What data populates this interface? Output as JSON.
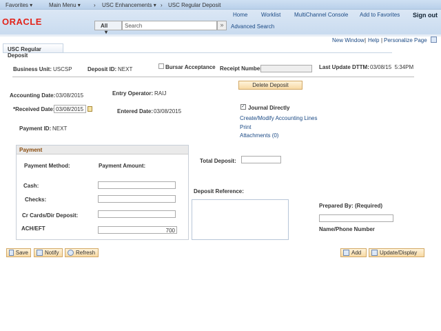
{
  "nav": {
    "favorites": "Favorites ▾",
    "main_menu": "Main Menu ▾",
    "sep1": "›",
    "enh": "USC Enhancements ▾",
    "sep2": "›",
    "page": "USC Regular Deposit"
  },
  "header": {
    "logo": "ORACLE",
    "home": "Home",
    "worklist": "Worklist",
    "mcc": "MultiChannel Console",
    "add_fav": "Add to Favorites",
    "sign_out": "Sign out",
    "search_scope": "All",
    "search_placeholder": "Search",
    "search_go": "»",
    "advanced": "Advanced Search"
  },
  "util": {
    "new_window": "New Window",
    "help": "Help",
    "personalize": "Personalize Page"
  },
  "tab": "USC Regular Deposit",
  "form": {
    "business_unit_label": "Business Unit:",
    "business_unit": "USCSP",
    "deposit_id_label": "Deposit ID:",
    "deposit_id": "NEXT",
    "bursar_label": "Bursar Acceptance",
    "bursar_checked": false,
    "receipt_label": "Receipt Number",
    "receipt_value": "",
    "last_update_label": "Last Update DTTM:",
    "last_update": "03/08/15  5:34PM",
    "delete_button": "Delete Deposit",
    "accounting_date_label": "Accounting Date:",
    "accounting_date": "03/08/2015",
    "entry_operator_label": "Entry Operator:",
    "entry_operator": "RAIJ",
    "received_date_label": "*Received Date:",
    "received_date": "03/08/2015",
    "entered_date_label": "Entered Date:",
    "entered_date": "03/08/2015",
    "journal_label": "Journal Directly",
    "journal_checked": true,
    "create_modify": "Create/Modify Accounting Lines",
    "print": "Print",
    "attachments": "Attachments (0)",
    "payment_id_label": "Payment ID:",
    "payment_id": "NEXT",
    "total_deposit_label": "Total Deposit:",
    "total_deposit": "",
    "deposit_ref_label": "Deposit Reference:",
    "deposit_ref": "",
    "prepared_by_label": "Prepared By: (Required)",
    "prepared_by": "",
    "name_phone_label": "Name/Phone Number"
  },
  "payment": {
    "title": "Payment",
    "method_header": "Payment Method:",
    "amount_header": "Payment Amount:",
    "rows": [
      {
        "label": "Cash:",
        "value": ""
      },
      {
        "label": "Checks:",
        "value": ""
      },
      {
        "label": "Cr Cards/Dir Deposit:",
        "value": ""
      },
      {
        "label": "ACH/EFT",
        "value": "700"
      }
    ]
  },
  "toolbar": {
    "save": "Save",
    "notify": "Notify",
    "refresh": "Refresh",
    "add": "Add",
    "update": "Update/Display"
  },
  "colors": {
    "accent": "#1b4a85",
    "oracle_red": "#e2231a",
    "button": "#f7d9a4"
  }
}
